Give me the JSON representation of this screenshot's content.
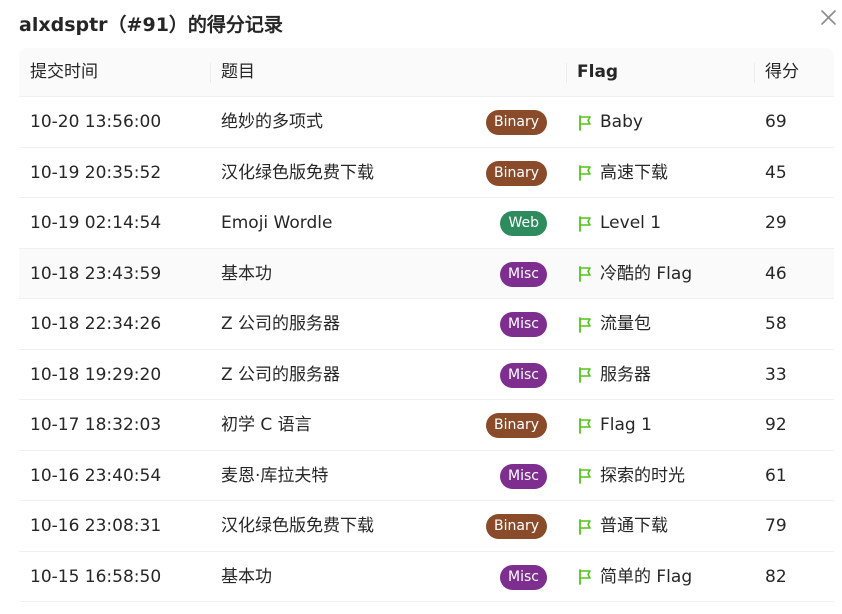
{
  "modal": {
    "title": "alxdsptr（#91）的得分记录",
    "close_icon": "close-icon"
  },
  "table": {
    "headers": {
      "time": "提交时间",
      "challenge": "题目",
      "flag": "Flag",
      "score": "得分"
    },
    "rows": [
      {
        "time": "10-20 13:56:00",
        "challenge": "绝妙的多项式",
        "category": "Binary",
        "flag": "Baby",
        "score": "69"
      },
      {
        "time": "10-19 20:35:52",
        "challenge": "汉化绿色版免费下载",
        "category": "Binary",
        "flag": "高速下载",
        "score": "45"
      },
      {
        "time": "10-19 02:14:54",
        "challenge": "Emoji Wordle",
        "category": "Web",
        "flag": "Level 1",
        "score": "29"
      },
      {
        "time": "10-18 23:43:59",
        "challenge": "基本功",
        "category": "Misc",
        "flag": "冷酷的 Flag",
        "score": "46"
      },
      {
        "time": "10-18 22:34:26",
        "challenge": "Z 公司的服务器",
        "category": "Misc",
        "flag": "流量包",
        "score": "58"
      },
      {
        "time": "10-18 19:29:20",
        "challenge": "Z 公司的服务器",
        "category": "Misc",
        "flag": "服务器",
        "score": "33"
      },
      {
        "time": "10-17 18:32:03",
        "challenge": "初学 C 语言",
        "category": "Binary",
        "flag": "Flag 1",
        "score": "92"
      },
      {
        "time": "10-16 23:40:54",
        "challenge": "麦恩·库拉夫特",
        "category": "Misc",
        "flag": "探索的时光",
        "score": "61"
      },
      {
        "time": "10-16 23:08:31",
        "challenge": "汉化绿色版免费下载",
        "category": "Binary",
        "flag": "普通下载",
        "score": "79"
      },
      {
        "time": "10-15 16:58:50",
        "challenge": "基本功",
        "category": "Misc",
        "flag": "简单的 Flag",
        "score": "82"
      }
    ]
  },
  "colors": {
    "Binary": "#8a4b2a",
    "Web": "#2e8b5e",
    "Misc": "#7d2e8e",
    "flag_icon": "#52c41a",
    "header_bg": "#fafafa",
    "row_border": "#f0f0f0"
  },
  "icons": {
    "flag": "flag-icon"
  }
}
